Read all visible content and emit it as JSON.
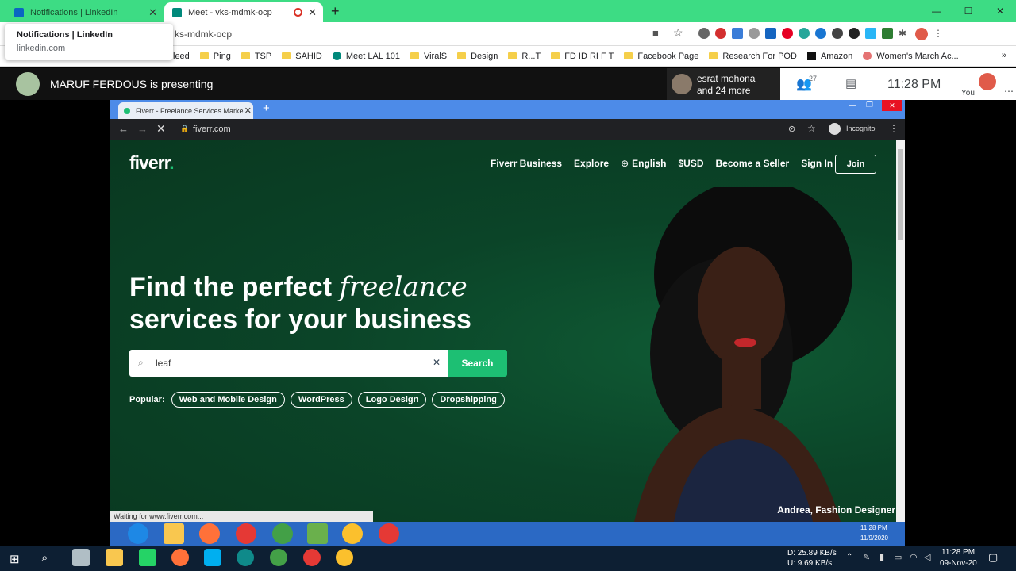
{
  "outer_tabs": [
    {
      "title": "Notifications | LinkedIn",
      "fav": "#0a66c2"
    },
    {
      "title": "Meet - vks-mdmk-ocp",
      "fav": "#00897b"
    }
  ],
  "tooltip": {
    "title": "Notifications | LinkedIn",
    "url": "linkedin.com"
  },
  "address": {
    "url": "ks-mdmk-ocp"
  },
  "bookmarks": [
    {
      "label": "leed",
      "type": "text"
    },
    {
      "label": "Ping",
      "type": "folder"
    },
    {
      "label": "TSP",
      "type": "folder"
    },
    {
      "label": "SAHID",
      "type": "folder"
    },
    {
      "label": "Meet LAL 101",
      "type": "site"
    },
    {
      "label": "ViralS",
      "type": "folder"
    },
    {
      "label": "Design",
      "type": "folder"
    },
    {
      "label": "R...T",
      "type": "folder"
    },
    {
      "label": "FD ID RI F T",
      "type": "folder"
    },
    {
      "label": "Facebook Page",
      "type": "folder"
    },
    {
      "label": "Research For POD",
      "type": "folder"
    },
    {
      "label": "Amazon",
      "type": "site"
    },
    {
      "label": "Women's March Ac...",
      "type": "site"
    }
  ],
  "meet": {
    "presenter": "MARUF FERDOUS is presenting",
    "speaker_name": "esrat mohona",
    "speaker_more": "and 24 more",
    "participants_count": "27",
    "time": "11:28 PM",
    "you_label": "You"
  },
  "inner_browser": {
    "tab_title": "Fiverr - Freelance Services Marke",
    "url": "fiverr.com",
    "incognito": "Incognito",
    "status": "Waiting for www.fiverr.com..."
  },
  "fiverr": {
    "logo": "fiverr",
    "logo_dot": ".",
    "nav": [
      "Fiverr Business",
      "Explore",
      "English",
      "$USD",
      "Become a Seller",
      "Sign In"
    ],
    "join": "Join",
    "headline_1": "Find the perfect ",
    "headline_italic": "freelance",
    "headline_2": "services for your business",
    "search_value": "leaf",
    "search_button": "Search",
    "popular_label": "Popular:",
    "popular": [
      "Web and Mobile Design",
      "WordPress",
      "Logo Design",
      "Dropshipping"
    ],
    "caption": "Andrea, Fashion Designer",
    "brand_green": "#1dbf73"
  },
  "inner_taskbar": {
    "time": "11:28 PM",
    "date": "11/9/2020"
  },
  "taskbar": {
    "net_down_label": "D:",
    "net_down": "25.89 KB/s",
    "net_up_label": "U:",
    "net_up": "9.69 KB/s",
    "time": "11:28 PM",
    "date": "09-Nov-20"
  }
}
